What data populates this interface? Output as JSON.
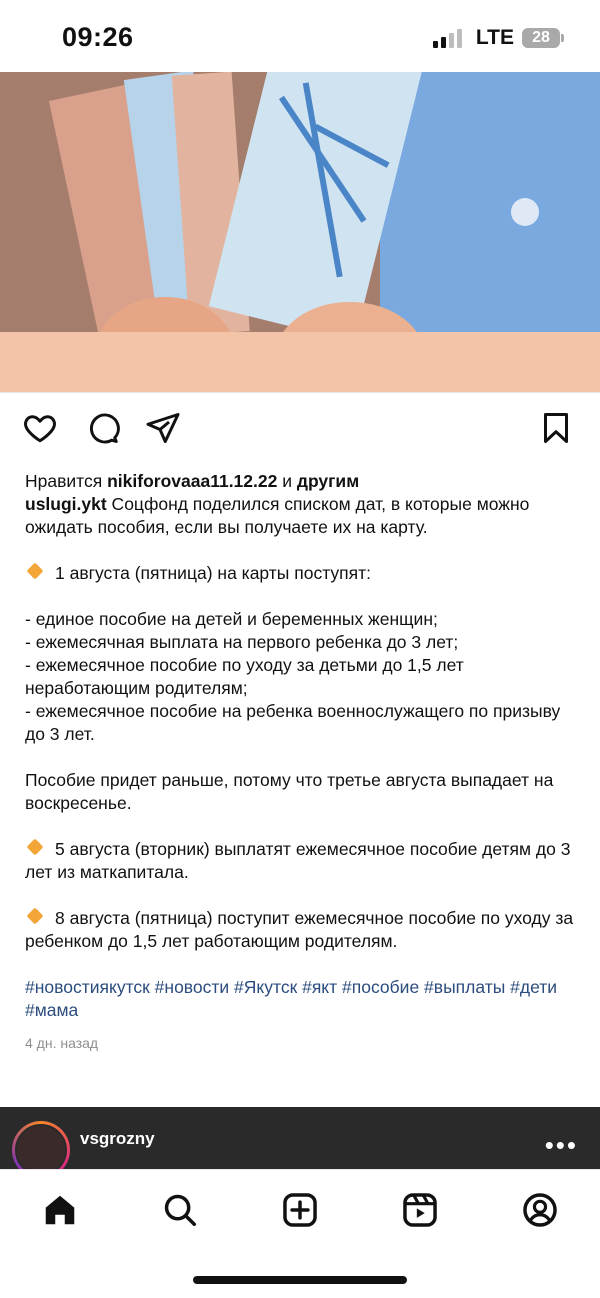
{
  "status_bar": {
    "time": "09:26",
    "network": "LTE",
    "battery": "28"
  },
  "post": {
    "likes_prefix": "Нравится ",
    "likes_user": "nikiforovaaa11.12.22",
    "likes_and": " и ",
    "likes_others": "другим",
    "author": "uslugi.ykt",
    "intro": " Соцфонд поделился списком дат, в которые можно ожидать пособия, если вы получаете их на карту.",
    "item1_title": "1 августа (пятница) на карты поступят:",
    "item1_bullets": [
      "- единое пособие на детей и беременных женщин;",
      "- ежемесячная выплата на первого ребенка до 3 лет;",
      "- ежемесячное пособие по уходу за детьми до 1,5 лет неработающим родителям;",
      "- ежемесячное пособие на ребенка военнослужащего по призыву до 3 лет."
    ],
    "note": "Пособие придет раньше, потому что третье августа выпадает на воскресенье.",
    "item2": "5 августа (вторник) выплатят ежемесячное пособие детям до 3 лет из маткапитала.",
    "item3": "8 августа (пятница) поступит ежемесячное пособие по уходу за ребенком до 1,5 лет работающим родителям.",
    "hashtags": "#новостиякутск #новости #Якутск #якт #пособие #выплаты #дети #мама",
    "time_ago": "4 дн. назад"
  },
  "next_post": {
    "username": "vsgrozny",
    "more": "•••"
  },
  "icons": {
    "like": "heart-icon",
    "comment": "comment-icon",
    "share": "send-icon",
    "save": "bookmark-icon",
    "tabs": [
      "home-icon",
      "search-icon",
      "create-icon",
      "reels-icon",
      "profile-icon"
    ]
  },
  "colors": {
    "hashtag": "#2b4c7e",
    "emoji_diamond": "#f3a537",
    "band": "#f3c4a8"
  }
}
